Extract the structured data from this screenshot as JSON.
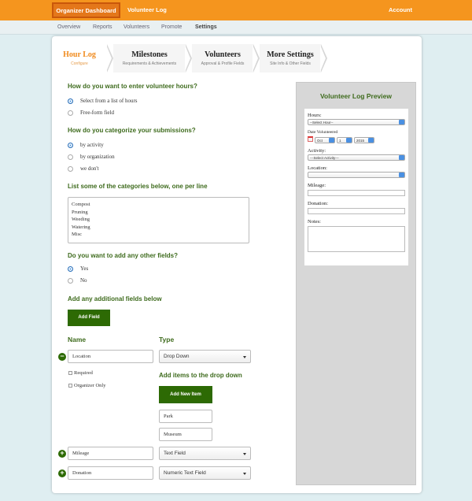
{
  "topnav": {
    "active_tab": "Organizer Dashboard",
    "volunteer_log": "Volunteer Log",
    "account": "Account"
  },
  "subnav": [
    "Overview",
    "Reports",
    "Volunteers",
    "Promote",
    "Settings"
  ],
  "steps": [
    {
      "title": "Hour Log",
      "subtitle": "Configure"
    },
    {
      "title": "Milestones",
      "subtitle": "Requirements & Achievements"
    },
    {
      "title": "Volunteers",
      "subtitle": "Approval & Profile Fields"
    },
    {
      "title": "More Settings",
      "subtitle": "Site Info & Other Fields"
    }
  ],
  "form": {
    "q1": "How do you want to enter volunteer hours?",
    "q1_opt1": "Select from a list of hours",
    "q1_opt2": "Free-form field",
    "q2": "How do you categorize your submissions?",
    "q2_opt1": "by activity",
    "q2_opt2": "by organization",
    "q2_opt3": "we don't",
    "q3": "List some of the categories below, one per line",
    "categories": [
      "Compost",
      "Pruning",
      "Weeding",
      "Watering",
      "Misc"
    ],
    "q4": "Do you want to add any other fields?",
    "q4_yes": "Yes",
    "q4_no": "No",
    "q5": "Add any additional fields below",
    "add_field": "Add Field",
    "col_name": "Name",
    "col_type": "Type",
    "field1_name": "Location",
    "field1_type": "Drop Down",
    "required_label": "Required",
    "organizer_only_label": "Organizer Only",
    "dropdown_heading": "Add items to the drop down",
    "add_new_item": "Add New Item",
    "item1": "Park",
    "item2": "Museum",
    "field2_name": "Mileage",
    "field2_type": "Text Field",
    "field3_name": "Donation",
    "field3_type": "Numeric Text Field"
  },
  "preview": {
    "title": "Volunteer Log Preview",
    "hours_label": "Hours:",
    "hours_select": "--Select Hour--",
    "date_label": "Date Volunteered",
    "date_month": "Oct",
    "date_day": "1",
    "date_year": "2015",
    "activity_label": "Activity:",
    "activity_select": "---Select Activity---",
    "location_label": "Location:",
    "mileage_label": "Mileage:",
    "donation_label": "Donation:",
    "notes_label": "Notes:"
  }
}
